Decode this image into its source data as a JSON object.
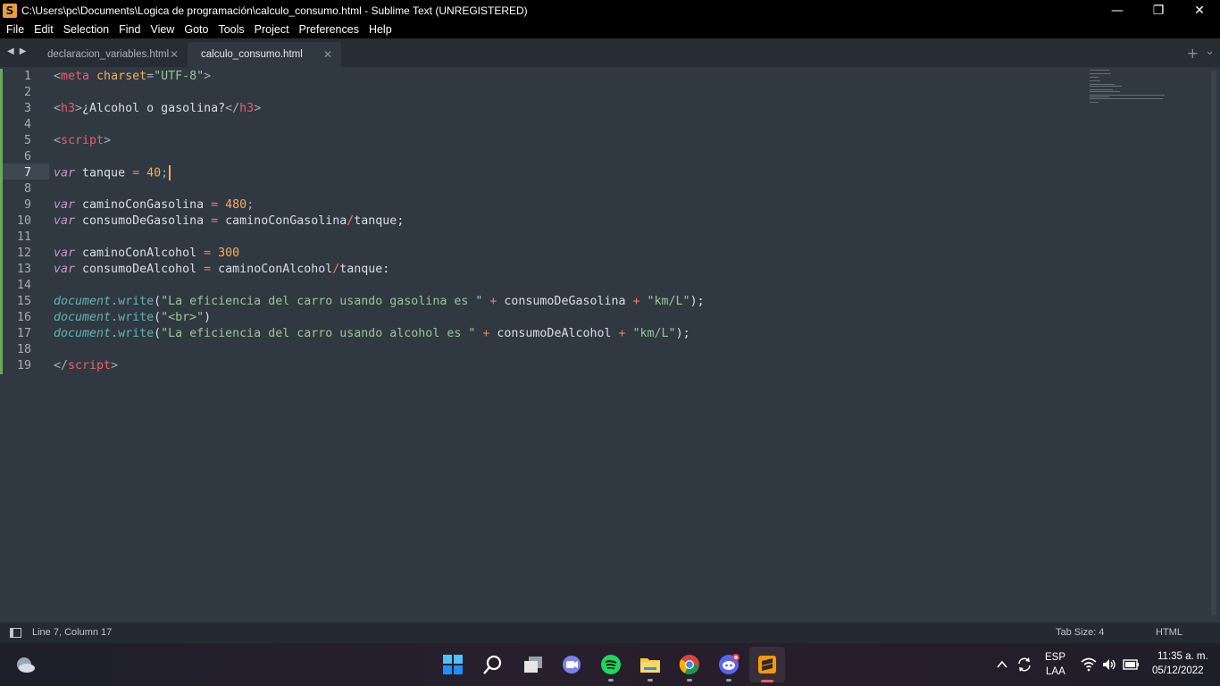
{
  "window": {
    "title": "C:\\Users\\pc\\Documents\\Logica de programación\\calculo_consumo.html - Sublime Text (UNREGISTERED)",
    "app_icon": "S",
    "minimize_icon": "—",
    "restore_icon": "❐",
    "close_icon": "✕"
  },
  "menu": [
    "File",
    "Edit",
    "Selection",
    "Find",
    "View",
    "Goto",
    "Tools",
    "Project",
    "Preferences",
    "Help"
  ],
  "tabs": [
    {
      "label": "declaracion_variables.html",
      "active": false
    },
    {
      "label": "calculo_consumo.html",
      "active": true
    }
  ],
  "tab_close_glyph": "✕",
  "tab_nav": {
    "left": "◀",
    "right": "▶",
    "new_tab": "+",
    "overflow": "⌄"
  },
  "editor": {
    "line_numbers": [
      "1",
      "2",
      "3",
      "4",
      "5",
      "6",
      "7",
      "8",
      "9",
      "10",
      "11",
      "12",
      "13",
      "14",
      "15",
      "16",
      "17",
      "18",
      "19"
    ],
    "active_line": 7,
    "tokens": {
      "l1": [
        "<",
        "meta",
        " charset",
        "=",
        "\"UTF-8\"",
        ">"
      ],
      "l3": [
        "<",
        "h3",
        ">",
        "¿Alcohol o gasolina?",
        "</",
        "h3",
        ">"
      ],
      "l5": [
        "<",
        "script",
        ">"
      ],
      "l7": [
        "var",
        " tanque ",
        "=",
        " ",
        "40",
        ";"
      ],
      "l9": [
        "var",
        " caminoConGasolina ",
        "=",
        " ",
        "480",
        ";"
      ],
      "l10": [
        "var",
        " consumoDeGasolina ",
        "=",
        " caminoConGasolina",
        "/",
        "tanque;"
      ],
      "l12": [
        "var",
        " caminoConAlcohol ",
        "=",
        " ",
        "300"
      ],
      "l13": [
        "var",
        " consumoDeAlcohol ",
        "=",
        " caminoConAlcohol",
        "/",
        "tanque:"
      ],
      "l15": [
        "document",
        ".",
        "write",
        "(",
        "\"La eficiencia del carro usando gasolina es \"",
        " ",
        "+",
        " consumoDeGasolina ",
        "+",
        " ",
        "\"km/L\"",
        ");"
      ],
      "l16": [
        "document",
        ".",
        "write",
        "(",
        "\"<br>\"",
        ")"
      ],
      "l17": [
        "document",
        ".",
        "write",
        "(",
        "\"La eficiencia del carro usando alcohol es \"",
        " ",
        "+",
        " consumoDeAlcohol ",
        "+",
        " ",
        "\"km/L\"",
        ");"
      ],
      "l19": [
        "</",
        "script",
        ">"
      ]
    }
  },
  "status": {
    "position": "Line 7, Column 17",
    "tab_size": "Tab Size: 4",
    "syntax": "HTML"
  },
  "taskbar": {
    "apps": [
      "weather-icon",
      "start-icon",
      "search-icon",
      "task-view-icon",
      "chat-icon",
      "spotify-icon",
      "file-explorer-icon",
      "chrome-icon",
      "discord-icon",
      "sublime-text-icon"
    ],
    "lang_top": "ESP",
    "lang_bottom": "LAA",
    "time": "11:35 a. m.",
    "date": "05/12/2022"
  },
  "colors": {
    "editor_bg": "#303841",
    "tag": "#ec5f66",
    "string": "#99c794",
    "keyword": "#c695c6",
    "number": "#f9ae58",
    "function": "#5fb4b4"
  }
}
